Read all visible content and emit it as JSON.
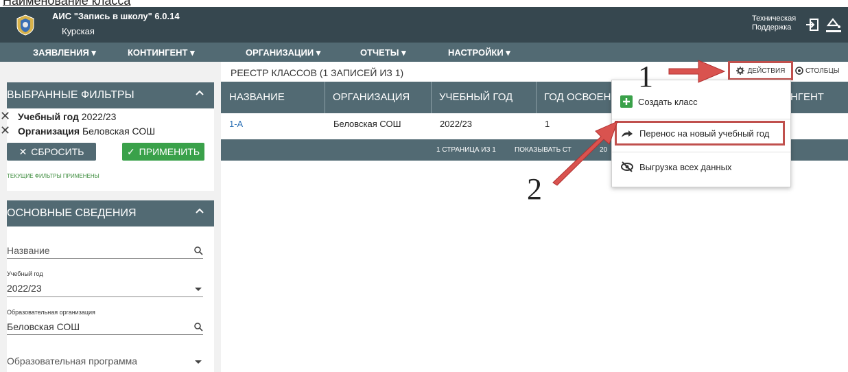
{
  "top_strip_text": "Наименование класса",
  "header": {
    "app_title": "АИС \"Запись в школу\" 6.0.14",
    "region": "Курская",
    "support_line1": "Техническая",
    "support_line2": "Поддержка"
  },
  "nav": {
    "items": [
      {
        "label": "ЗАЯВЛЕНИЯ ▾"
      },
      {
        "label": "КОНТИНГЕНТ ▾"
      },
      {
        "label": "ОРГАНИЗАЦИИ ▾"
      },
      {
        "label": "ОТЧЕТЫ ▾"
      },
      {
        "label": "НАСТРОЙКИ ▾"
      }
    ]
  },
  "filters_panel": {
    "title": "ВЫБРАННЫЕ ФИЛЬТРЫ",
    "filters": [
      {
        "key": "Учебный год",
        "value": "2022/23"
      },
      {
        "key": "Организация",
        "value": "Беловская СОШ"
      }
    ],
    "reset_label": "СБРОСИТЬ",
    "apply_label": "ПРИМЕНИТЬ",
    "status": "ТЕКУЩИЕ ФИЛЬТРЫ ПРИМЕНЕНЫ"
  },
  "basic_panel": {
    "title": "ОСНОВНЫЕ СВЕДЕНИЯ",
    "name_placeholder": "Название",
    "year_label": "Учебный год",
    "year_value": "2022/23",
    "org_label": "Образовательная организация",
    "org_value": "Беловская СОШ",
    "program_placeholder": "Образовательная программа"
  },
  "main": {
    "registry_title": "РЕЕСТР КЛАССОВ (1 ЗАПИСЕЙ ИЗ 1)",
    "columns": [
      "НАЗВАНИЕ",
      "ОРГАНИЗАЦИЯ",
      "УЧЕБНЫЙ ГОД",
      "ГОД ОСВОЕНИ",
      "НГЕНТ"
    ],
    "rows": [
      {
        "name": "1-А",
        "org": "Беловская СОШ",
        "year": "2022/23",
        "study_year": "1"
      }
    ],
    "pagination": "1 СТРАНИЦА ИЗ 1",
    "show_label": "ПОКАЗЫВАТЬ СТ",
    "page_size": "20"
  },
  "toolbar": {
    "actions_label": "ДЕЙСТВИЯ",
    "columns_label": "СТОЛБЦЫ"
  },
  "menu": {
    "items": [
      {
        "label": "Создать класс",
        "icon": "plus-icon"
      },
      {
        "label": "Перенос на новый учебный год",
        "icon": "transfer-arrow-icon"
      },
      {
        "label": "Выгрузка всех данных",
        "icon": "eye-slash-icon"
      }
    ]
  },
  "annotations": {
    "marker1": "1",
    "marker2": "2"
  },
  "colors": {
    "header": "#36474f",
    "nav": "#526a73",
    "apply": "#3aa14a",
    "highlight": "#c0504d"
  }
}
